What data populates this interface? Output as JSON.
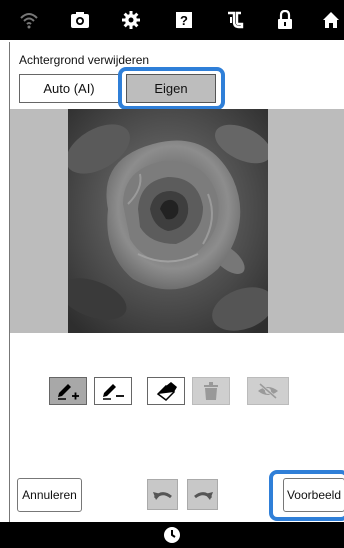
{
  "dialog": {
    "title": "Achtergrond verwijderen",
    "mode_auto_label": "Auto (AI)",
    "mode_custom_label": "Eigen",
    "selected_mode": "Eigen"
  },
  "toolbar_icons": [
    "wifi-icon",
    "camera-icon",
    "settings-icon",
    "help-icon",
    "machine-icon",
    "lock-icon",
    "home-icon"
  ],
  "tools": [
    {
      "name": "add-area-pen",
      "state": "active"
    },
    {
      "name": "remove-area-pen",
      "state": "normal"
    },
    {
      "name": "eraser",
      "state": "normal"
    },
    {
      "name": "delete",
      "state": "disabled"
    },
    {
      "name": "hide-preview",
      "state": "disabled"
    }
  ],
  "buttons": {
    "cancel_label": "Annuleren",
    "preview_label": "Voorbeeld"
  },
  "colors": {
    "highlight": "#2f7fd8",
    "background_area": "#bcbcbc",
    "selected_button": "#bdbdbd"
  }
}
